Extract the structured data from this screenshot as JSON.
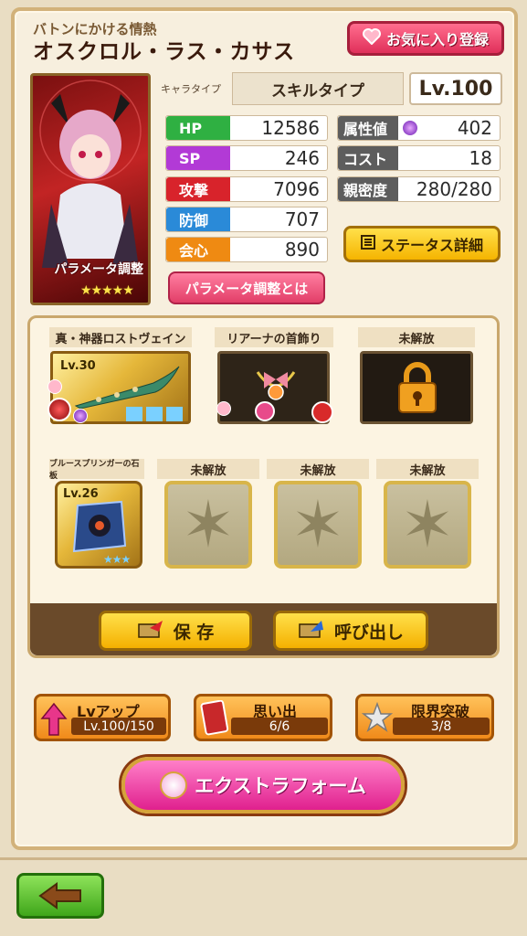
{
  "header": {
    "subtitle": "バトンにかける情熱",
    "name": "オスクロル・ラス・カサス",
    "favorite_label": "お気に入り登録"
  },
  "portrait": {
    "param_tag": "パラメータ調整",
    "stars": "★★★★★"
  },
  "info": {
    "chara_type_label": "キャラタイプ",
    "skill_type": "スキルタイプ",
    "level": "Lv.100"
  },
  "stats_left": [
    {
      "key": "HP",
      "value": "12586",
      "color": "#2fb042"
    },
    {
      "key": "SP",
      "value": "246",
      "color": "#b23ad6"
    },
    {
      "key": "攻撃",
      "value": "7096",
      "color": "#d8232b"
    },
    {
      "key": "防御",
      "value": "707",
      "color": "#2a8ad8"
    },
    {
      "key": "会心",
      "value": "890",
      "color": "#ef8a12"
    }
  ],
  "stats_right": [
    {
      "key": "属性値",
      "value": "402",
      "color": "#5d5d5d"
    },
    {
      "key": "コスト",
      "value": "18",
      "color": "#5d5d5d"
    },
    {
      "key": "親密度",
      "value": "280/280",
      "color": "#5d5d5d"
    }
  ],
  "buttons": {
    "status_detail": "ステータス詳細",
    "param_help": "パラメータ調整とは",
    "save": "保 存",
    "load": "呼び出し"
  },
  "equipment": {
    "weapon": {
      "name": "真・神器ロストヴェイン",
      "level": "Lv.30"
    },
    "accessory": {
      "name": "リアーナの首飾り"
    },
    "locked1": {
      "name": "未解放"
    },
    "stone": {
      "name": "ブルースプリンガーの石板",
      "level": "Lv.26",
      "stars": "★★★"
    },
    "locked2": {
      "name": "未解放"
    },
    "locked3": {
      "name": "未解放"
    },
    "locked4": {
      "name": "未解放"
    }
  },
  "progress": {
    "lvup": {
      "label": "Lvアップ",
      "value": "Lv.100/150"
    },
    "memories": {
      "label": "思い出",
      "value": "6/6"
    },
    "limit": {
      "label": "限界突破",
      "value": "3/8"
    }
  },
  "extra_form": "エクストラフォーム",
  "icons": [
    "heart-icon",
    "list-icon",
    "lock-icon",
    "back-arrow-icon",
    "star-icon",
    "card-icon",
    "save-icon",
    "load-icon"
  ]
}
